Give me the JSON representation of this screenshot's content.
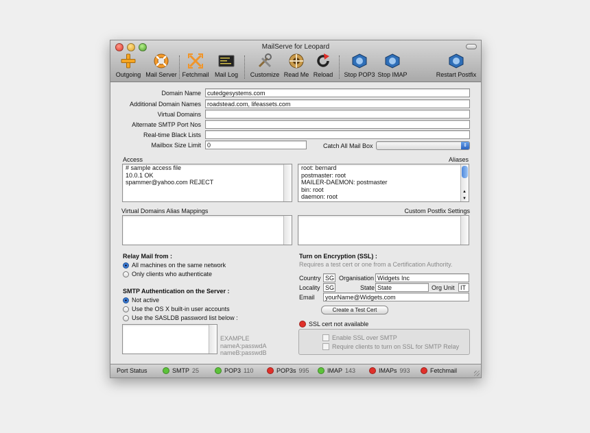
{
  "window": {
    "title": "MailServe for Leopard"
  },
  "toolbar": [
    {
      "label": "Outgoing",
      "icon": "plus-icon"
    },
    {
      "label": "Mail Server",
      "icon": "lifebuoy-icon"
    },
    {
      "label": "Fetchmail",
      "icon": "arrows-icon"
    },
    {
      "label": "Mail Log",
      "icon": "console-icon"
    },
    {
      "label": "Customize",
      "icon": "tools-icon"
    },
    {
      "label": "Read Me",
      "icon": "help-icon"
    },
    {
      "label": "Reload",
      "icon": "reload-icon"
    },
    {
      "label": "Stop POP3",
      "icon": "stop-pop3-icon"
    },
    {
      "label": "Stop IMAP",
      "icon": "stop-imap-icon"
    },
    {
      "label": "Restart Postfix",
      "icon": "restart-postfix-icon"
    }
  ],
  "form": {
    "domain_name": {
      "label": "Domain Name",
      "value": "cutedgesystems.com"
    },
    "additional_domains": {
      "label": "Additional Domain Names",
      "value": "roadstead.com, lifeassets.com"
    },
    "virtual_domains": {
      "label": "Virtual Domains",
      "value": ""
    },
    "alt_smtp_ports": {
      "label": "Alternate SMTP Port Nos",
      "value": ""
    },
    "blacklists": {
      "label": "Real-time Black Lists",
      "value": ""
    },
    "mailbox_limit": {
      "label": "Mailbox Size Limit",
      "value": "0"
    },
    "catch_all": {
      "label": "Catch All Mail Box",
      "value": ""
    }
  },
  "access": {
    "title": "Access",
    "lines": [
      "# sample access file",
      "10.0.1 OK",
      "spammer@yahoo.com REJECT"
    ]
  },
  "aliases": {
    "title": "Aliases",
    "lines": [
      "root: bernard",
      "postmaster: root",
      "MAILER-DAEMON: postmaster",
      "bin: root",
      "daemon: root"
    ]
  },
  "virtual_alias": {
    "title": "Virtual Domains Alias Mappings"
  },
  "custom_postfix": {
    "title": "Custom Postfix Settings"
  },
  "relay": {
    "title": "Relay Mail from :",
    "options": [
      "All machines on the same network",
      "Only clients who authenticate"
    ],
    "selected": 0
  },
  "smtp_auth": {
    "title": "SMTP Authentication on the Server :",
    "options": [
      "Not active",
      "Use the OS X built-in user accounts",
      "Use the SASLDB password list below :"
    ],
    "selected": 0
  },
  "sasl_example": {
    "lines": [
      "EXAMPLE",
      "nameA:passwdA",
      "nameB:passwdB"
    ]
  },
  "ssl": {
    "title": "Turn on Encryption (SSL) :",
    "subtitle": "Requires a test cert or one from a Certification Authority.",
    "country_label": "Country",
    "country": "SG",
    "org_label": "Organisation",
    "org": "Widgets Inc",
    "locality_label": "Locality",
    "locality": "SG",
    "state_label": "State",
    "state": "State",
    "org_unit_label": "Org Unit",
    "org_unit": "IT",
    "email_label": "Email",
    "email": "yourName@Widgets.com",
    "create_button": "Create a Test Cert",
    "status": "SSL cert not available",
    "status_color": "#e0302a",
    "enable_smtp": "Enable SSL over SMTP",
    "require_relay": "Require clients to turn on SSL for SMTP Relay"
  },
  "status_bar": {
    "label": "Port Status",
    "items": [
      {
        "name": "SMTP",
        "port": "25",
        "color": "#5cc23a"
      },
      {
        "name": "POP3",
        "port": "110",
        "color": "#5cc23a"
      },
      {
        "name": "POP3s",
        "port": "995",
        "color": "#e0302a"
      },
      {
        "name": "IMAP",
        "port": "143",
        "color": "#5cc23a"
      },
      {
        "name": "IMAPs",
        "port": "993",
        "color": "#e0302a"
      },
      {
        "name": "Fetchmail",
        "port": "",
        "color": "#e0302a"
      }
    ]
  }
}
